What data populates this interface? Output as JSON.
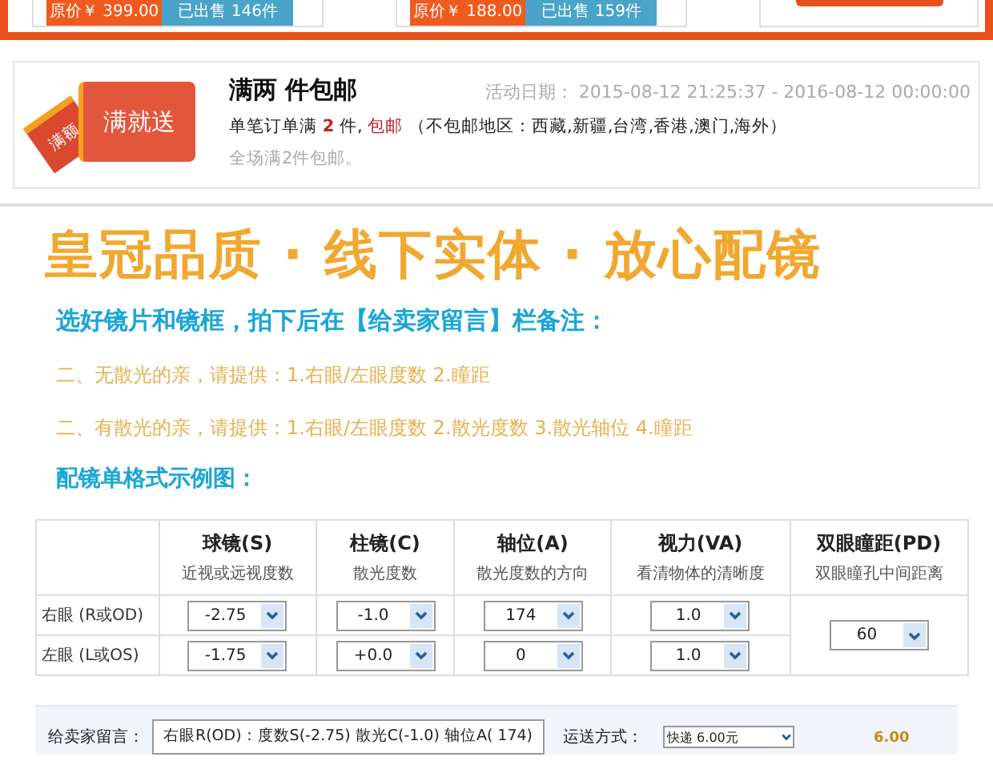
{
  "products": [
    {
      "price": "原价￥ 399.00",
      "sold": "已出售 146件"
    },
    {
      "price": "原价￥ 188.00",
      "sold": "已出售 159件"
    }
  ],
  "promo": {
    "badge": "满就送",
    "tag": "满额",
    "title": "满两 件包邮",
    "date_label": "活动日期：",
    "date_range": "2015-08-12 21:25:37 - 2016-08-12 00:00:00",
    "rule_prefix": "单笔订单满",
    "rule_count": "2",
    "rule_unit": "件,",
    "rule_link": "包邮",
    "rule_note": "（不包邮地区：西藏,新疆,台湾,香港,澳门,海外）",
    "footnote": "全场满2件包邮。"
  },
  "headline": "皇冠品质 · 线下实体 · 放心配镜",
  "instruction": "选好镜片和镜框，拍下后在【给卖家留言】栏备注：",
  "notes": [
    "二、无散光的亲，请提供：1.右眼/左眼度数 2.瞳距",
    "二、有散光的亲，请提供：1.右眼/左眼度数 2.散光度数 3.散光轴位 4.瞳距"
  ],
  "example_title": "配镜单格式示例图：",
  "table": {
    "columns": [
      {
        "title": "球镜(S)",
        "hint": "近视或远视度数"
      },
      {
        "title": "柱镜(C)",
        "hint": "散光度数"
      },
      {
        "title": "轴位(A)",
        "hint": "散光度数的方向"
      },
      {
        "title": "视力(VA)",
        "hint": "看清物体的清晰度"
      },
      {
        "title": "双眼瞳距(PD)",
        "hint": "双眼瞳孔中间距离"
      }
    ],
    "rows": [
      {
        "label": "右眼 (R或OD)",
        "values": [
          "-2.75",
          "-1.0",
          "174",
          "1.0"
        ]
      },
      {
        "label": "左眼 (L或OS)",
        "values": [
          "-1.75",
          "+0.0",
          "0",
          "1.0"
        ]
      }
    ],
    "pd": "60"
  },
  "order": {
    "message_label": "给卖家留言：",
    "message": "右眼R(OD)：度数S(-2.75)  散光C(-1.0)  轴位A( 174)",
    "shipping_label": "运送方式：",
    "shipping": "快递 6.00元",
    "cost": "6.00"
  }
}
